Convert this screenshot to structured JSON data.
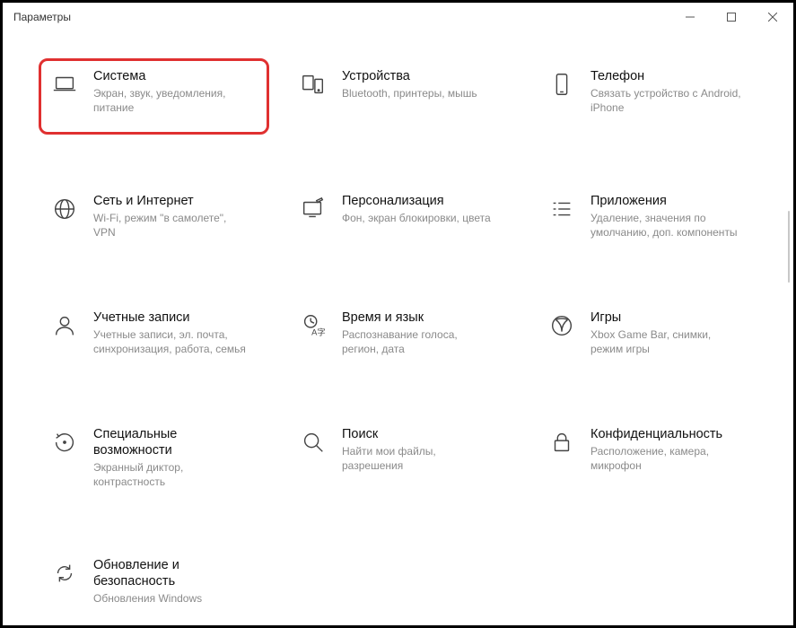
{
  "window": {
    "title": "Параметры"
  },
  "tiles": {
    "system": {
      "title": "Система",
      "desc": "Экран, звук, уведомления, питание"
    },
    "devices": {
      "title": "Устройства",
      "desc": "Bluetooth, принтеры, мышь"
    },
    "phone": {
      "title": "Телефон",
      "desc": "Связать устройство с Android, iPhone"
    },
    "network": {
      "title": "Сеть и Интернет",
      "desc": "Wi-Fi, режим \"в самолете\", VPN"
    },
    "personal": {
      "title": "Персонализация",
      "desc": "Фон, экран блокировки, цвета"
    },
    "apps": {
      "title": "Приложения",
      "desc": "Удаление, значения по умолчанию, доп. компоненты"
    },
    "accounts": {
      "title": "Учетные записи",
      "desc": "Учетные записи, эл. почта, синхронизация, работа, семья"
    },
    "time": {
      "title": "Время и язык",
      "desc": "Распознавание голоса, регион, дата"
    },
    "gaming": {
      "title": "Игры",
      "desc": "Xbox Game Bar, снимки, режим игры"
    },
    "ease": {
      "title": "Специальные возможности",
      "desc": "Экранный диктор, контрастность"
    },
    "search": {
      "title": "Поиск",
      "desc": "Найти мои файлы, разрешения"
    },
    "privacy": {
      "title": "Конфиденциальность",
      "desc": "Расположение, камера, микрофон"
    },
    "update": {
      "title": "Обновление и безопасность",
      "desc": "Обновления Windows"
    }
  }
}
